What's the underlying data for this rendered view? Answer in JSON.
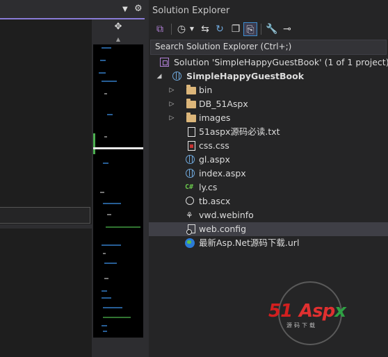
{
  "editor": {
    "dropdown_icon": "chevron-down-icon",
    "settings_icon": "gear-icon",
    "split_icon": "split-handle-icon"
  },
  "solution_explorer": {
    "title": "Solution Explorer",
    "search_placeholder": "Search Solution Explorer (Ctrl+;)",
    "toolbar": [
      "vs-switch-view-icon",
      "history-icon",
      "chevron-down-icon",
      "sync-icon",
      "refresh-icon",
      "collapse-all-icon",
      "show-all-files-icon",
      "properties-wrench-icon",
      "preview-icon"
    ],
    "tree": [
      {
        "label": "Solution 'SimpleHappyGuestBook' (1 of 1 project)",
        "icon": "solution-icon",
        "level": 0,
        "arrow": ""
      },
      {
        "label": "SimpleHappyGuestBook",
        "icon": "website-globe-icon",
        "level": 0,
        "arrow": "expanded",
        "bold": true
      },
      {
        "label": "bin",
        "icon": "folder-icon",
        "level": 1,
        "arrow": "collapsed"
      },
      {
        "label": "DB_51Aspx",
        "icon": "folder-icon",
        "level": 1,
        "arrow": "collapsed"
      },
      {
        "label": "images",
        "icon": "folder-icon",
        "level": 1,
        "arrow": "collapsed"
      },
      {
        "label": "51aspx源码必读.txt",
        "icon": "text-file-icon",
        "level": 1,
        "arrow": ""
      },
      {
        "label": "css.css",
        "icon": "css-file-icon",
        "level": 1,
        "arrow": ""
      },
      {
        "label": "gl.aspx",
        "icon": "aspx-file-icon",
        "level": 1,
        "arrow": ""
      },
      {
        "label": "index.aspx",
        "icon": "aspx-file-icon",
        "level": 1,
        "arrow": ""
      },
      {
        "label": "ly.cs",
        "icon": "csharp-file-icon",
        "level": 1,
        "arrow": ""
      },
      {
        "label": "tb.ascx",
        "icon": "user-control-icon",
        "level": 1,
        "arrow": ""
      },
      {
        "label": "vwd.webinfo",
        "icon": "webinfo-file-icon",
        "level": 1,
        "arrow": ""
      },
      {
        "label": "web.config",
        "icon": "config-file-icon",
        "level": 1,
        "arrow": "",
        "selected": true
      },
      {
        "label": "最新Asp.Net源码下载.url",
        "icon": "internet-shortcut-icon",
        "level": 1,
        "arrow": ""
      }
    ]
  },
  "watermark": {
    "brand_a": "51",
    "brand_b": "Asp",
    "brand_c": "x",
    "tagline": "源码下载"
  },
  "colors": {
    "accent": "#8a7cd8",
    "background": "#252526",
    "selection": "#3f3f46",
    "folder": "#dcb67a"
  }
}
